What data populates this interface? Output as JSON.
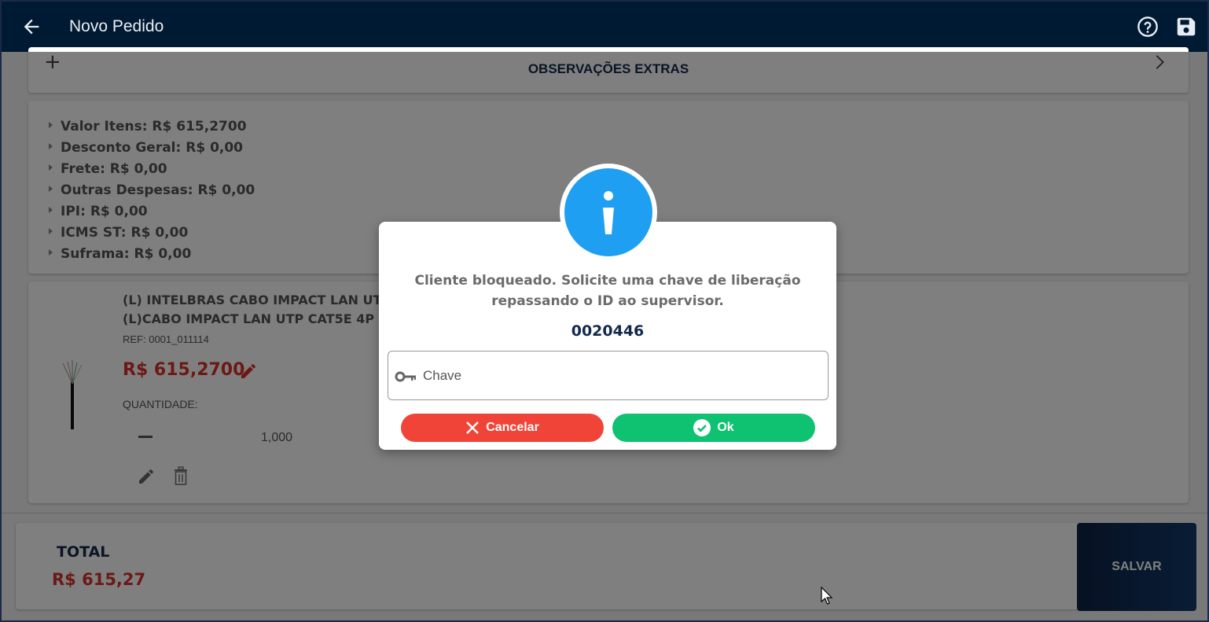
{
  "topbar": {
    "title": "Novo Pedido",
    "back_icon": "arrow-left-icon",
    "help_icon": "help-circle-icon",
    "save_icon": "floppy-disk-icon"
  },
  "observacoes": {
    "title": "OBSERVAÇÕES EXTRAS",
    "plus": "+"
  },
  "summary": {
    "items": [
      "Valor Itens: R$ 615,2700",
      "Desconto Geral: R$ 0,00",
      "Frete: R$ 0,00",
      "Outras Despesas: R$ 0,00",
      "IPI: R$ 0,00",
      "ICMS ST: R$ 0,00",
      "Suframa: R$ 0,00"
    ]
  },
  "item": {
    "name_line1": "(L) INTELBRAS CABO IMPACT LAN UTP",
    "name_line2": "(L)CABO IMPACT LAN UTP CAT5E 4P F",
    "ref": "REF: 0001_011114",
    "price": "R$ 615,2700",
    "quantity_label": "QUANTIDADE:",
    "quantity_value": "1,000"
  },
  "total": {
    "label": "TOTAL",
    "value": "R$ 615,27",
    "save_label": "SALVAR"
  },
  "dialog": {
    "message_line1": "Cliente bloqueado. Solicite uma chave de liberação",
    "message_line2": "repassando o ID ao supervisor.",
    "id": "0020446",
    "key_placeholder": "Chave",
    "cancel_label": "Cancelar",
    "ok_label": "Ok"
  },
  "colors": {
    "topbar": "#001a33",
    "price_red": "#d8322a",
    "navy": "#13294b",
    "info_blue": "#1e9ff2",
    "cancel_red": "#f04438",
    "ok_green": "#0ec271"
  }
}
